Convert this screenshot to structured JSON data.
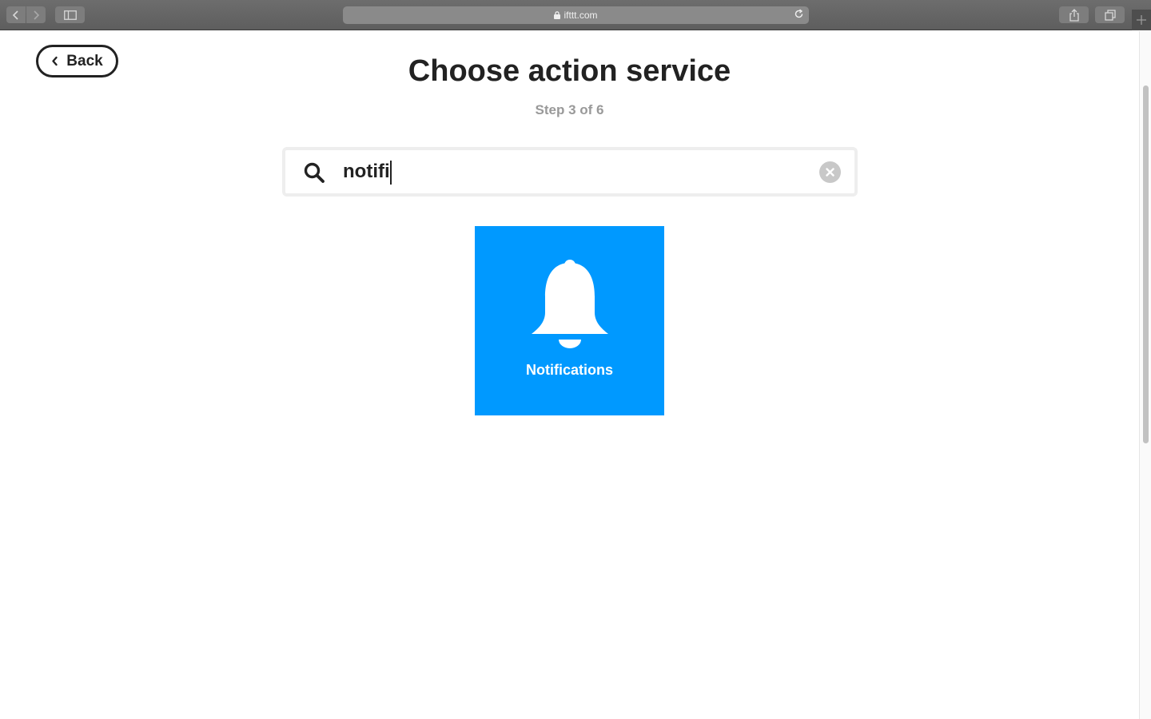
{
  "browser": {
    "url": "ifttt.com",
    "icons": [
      "chevron-left-icon",
      "chevron-right-icon",
      "sidebar-icon",
      "lock-icon",
      "reload-icon",
      "share-icon",
      "tabs-icon",
      "plus-icon"
    ]
  },
  "header": {
    "back_label": "Back",
    "title": "Choose action service",
    "step": "Step 3 of 6"
  },
  "search": {
    "value": "notifi",
    "icons": [
      "search-icon",
      "clear-icon"
    ]
  },
  "results": [
    {
      "label": "Notifications",
      "icon": "bell-icon",
      "color": "#0099ff"
    }
  ]
}
